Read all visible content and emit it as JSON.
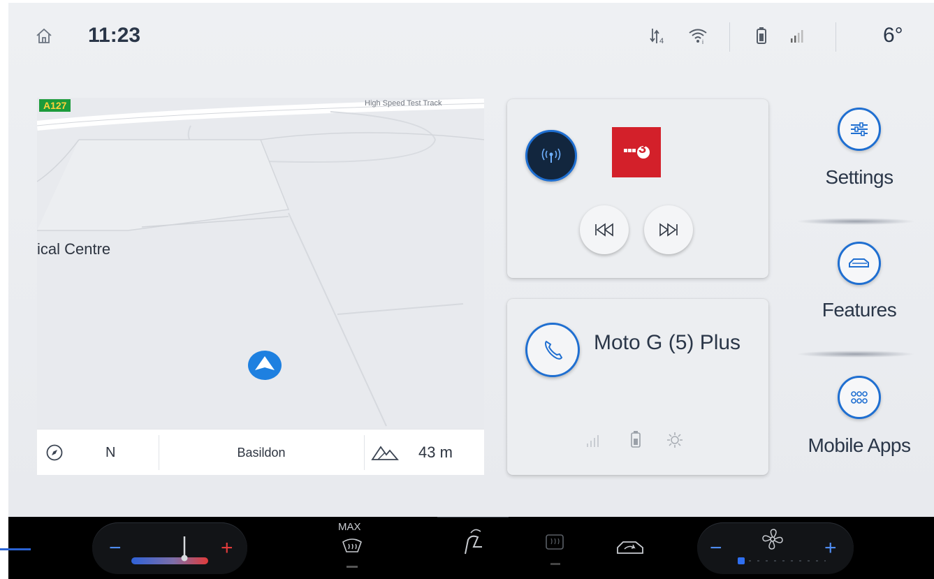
{
  "status": {
    "time": "11:23",
    "temperature": "6°"
  },
  "map": {
    "road_shield": "A127",
    "road_label": "High Speed Test Track",
    "poi_label": "ical Centre",
    "heading": "N",
    "location": "Basildon",
    "altitude": "43 m"
  },
  "radio": {
    "station_logo_text": "3",
    "prev_label": "Previous",
    "next_label": "Next"
  },
  "phone": {
    "device_name": "Moto G (5) Plus"
  },
  "side": {
    "settings": "Settings",
    "features": "Features",
    "mobile_apps": "Mobile Apps"
  },
  "climate": {
    "max_label": "MAX",
    "temp_minus": "−",
    "temp_plus": "+",
    "fan_minus": "−",
    "fan_plus": "+"
  },
  "colors": {
    "accent": "#1f6fd1",
    "station": "#d3202a",
    "nav_arrow": "#1e80e0"
  }
}
